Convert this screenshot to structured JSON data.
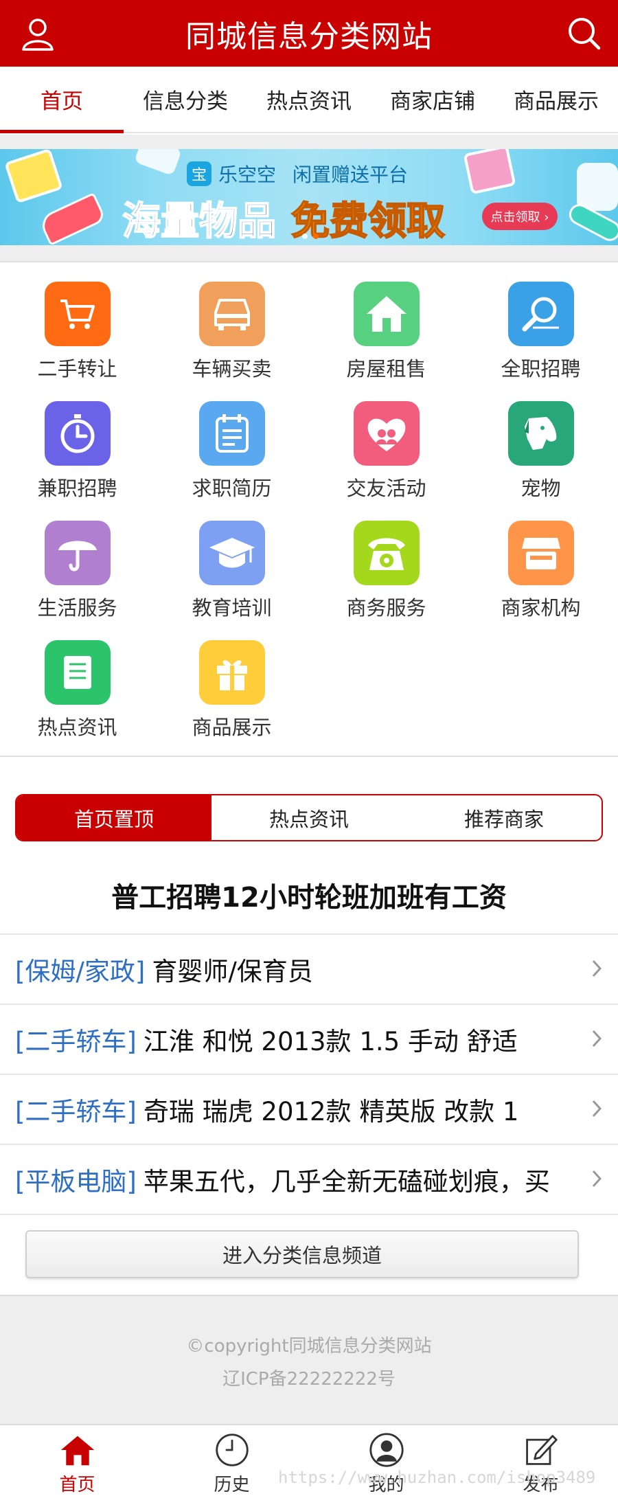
{
  "header": {
    "title": "同城信息分类网站",
    "user_icon": "user-icon",
    "search_icon": "search-icon",
    "bg_color": "#c80000"
  },
  "topnav": {
    "tabs": [
      {
        "label": "首页",
        "active": true
      },
      {
        "label": "信息分类",
        "active": false
      },
      {
        "label": "热点资讯",
        "active": false
      },
      {
        "label": "商家店铺",
        "active": false
      },
      {
        "label": "商品展示",
        "active": false
      }
    ]
  },
  "banner": {
    "brand_logo": "宝",
    "brand_name": "乐空空",
    "brand_sub": "闲置赠送平台",
    "headline_1": "海量物品",
    "headline_2": "免费领取",
    "cta": "点击领取 ›",
    "slide_count": 2,
    "active_slide": 2
  },
  "categories": [
    {
      "label": "二手转让",
      "icon": "shopping-cart-icon",
      "color": "#ff6a13"
    },
    {
      "label": "车辆买卖",
      "icon": "car-icon",
      "color": "#f0a05a"
    },
    {
      "label": "房屋租售",
      "icon": "house-icon",
      "color": "#57d07f"
    },
    {
      "label": "全职招聘",
      "icon": "magnifier-icon",
      "color": "#3aa1e6"
    },
    {
      "label": "兼职招聘",
      "icon": "stopwatch-icon",
      "color": "#6a63e8"
    },
    {
      "label": "求职简历",
      "icon": "notepad-icon",
      "color": "#5aa8f0"
    },
    {
      "label": "交友活动",
      "icon": "friends-heart-icon",
      "color": "#f25d7e"
    },
    {
      "label": "宠物",
      "icon": "dog-icon",
      "color": "#27a77a"
    },
    {
      "label": "生活服务",
      "icon": "umbrella-icon",
      "color": "#b07fcf"
    },
    {
      "label": "教育培训",
      "icon": "graduation-cap-icon",
      "color": "#7ea0f2"
    },
    {
      "label": "商务服务",
      "icon": "telephone-icon",
      "color": "#a4d81c"
    },
    {
      "label": "商家机构",
      "icon": "storefront-icon",
      "color": "#ff9548"
    },
    {
      "label": "热点资讯",
      "icon": "newspaper-icon",
      "color": "#2cc46a"
    },
    {
      "label": "商品展示",
      "icon": "gift-icon",
      "color": "#ffcd3a"
    }
  ],
  "segment": {
    "tabs": [
      {
        "label": "首页置顶",
        "active": true
      },
      {
        "label": "热点资讯",
        "active": false
      },
      {
        "label": "推荐商家",
        "active": false
      }
    ]
  },
  "featured_title": "普工招聘12小时轮班加班有工资",
  "listings": [
    {
      "category": "[保姆/家政]",
      "title": "育婴师/保育员"
    },
    {
      "category": "[二手轿车]",
      "title": "江淮 和悦 2013款 1.5 手动 舒适"
    },
    {
      "category": "[二手轿车]",
      "title": "奇瑞 瑞虎 2012款 精英版 改款 1"
    },
    {
      "category": "[平板电脑]",
      "title": "苹果五代，几乎全新无磕碰划痕，买"
    }
  ],
  "enter_button": "进入分类信息频道",
  "footer": {
    "copyright": "©copyright同城信息分类网站",
    "icp": "辽ICP备22222222号"
  },
  "tabbar": {
    "items": [
      {
        "label": "首页",
        "icon": "home-icon",
        "active": true
      },
      {
        "label": "历史",
        "icon": "clock-icon",
        "active": false
      },
      {
        "label": "我的",
        "icon": "profile-icon",
        "active": false
      },
      {
        "label": "发布",
        "icon": "edit-icon",
        "active": false
      }
    ]
  },
  "watermark": "https://www.huzhan.com/ishop3489"
}
